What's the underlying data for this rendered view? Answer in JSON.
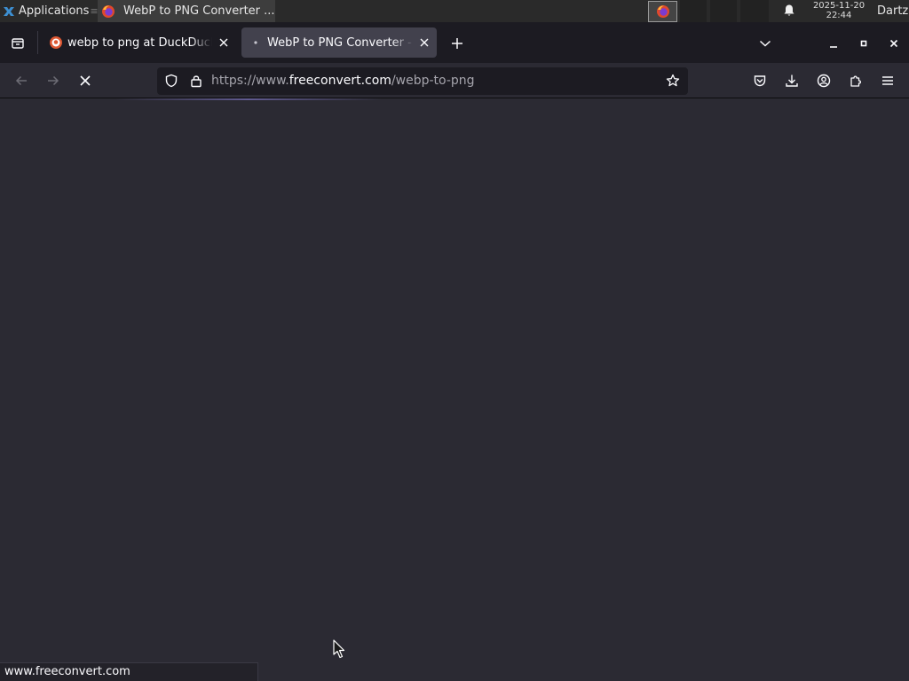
{
  "panel": {
    "applications_label": "Applications",
    "separator_glyph": "≡",
    "taskbar_item_title": "WebP to PNG Converter ...",
    "clock_date": "2025-11-20",
    "clock_time": "22:44",
    "user_name": "Dartz"
  },
  "tabs": [
    {
      "title": "webp to png at DuckDuckGo",
      "favicon": "duckduckgo-icon",
      "active": false
    },
    {
      "title": "WebP to PNG Converter - FreeConvert",
      "favicon": "loading-dot-icon",
      "active": true
    }
  ],
  "navbar": {
    "url_prefix": "https://www.",
    "url_host": "freeconvert.com",
    "url_path": "/webp-to-png",
    "loading": true
  },
  "statusbar": {
    "text": "www.freeconvert.com"
  },
  "colors": {
    "tabstrip_bg": "#1c1b22",
    "toolbar_bg": "#2b2a33",
    "active_tab_bg": "#42414d",
    "text": "#fbfbfe",
    "muted_text": "#a5a4ac"
  }
}
